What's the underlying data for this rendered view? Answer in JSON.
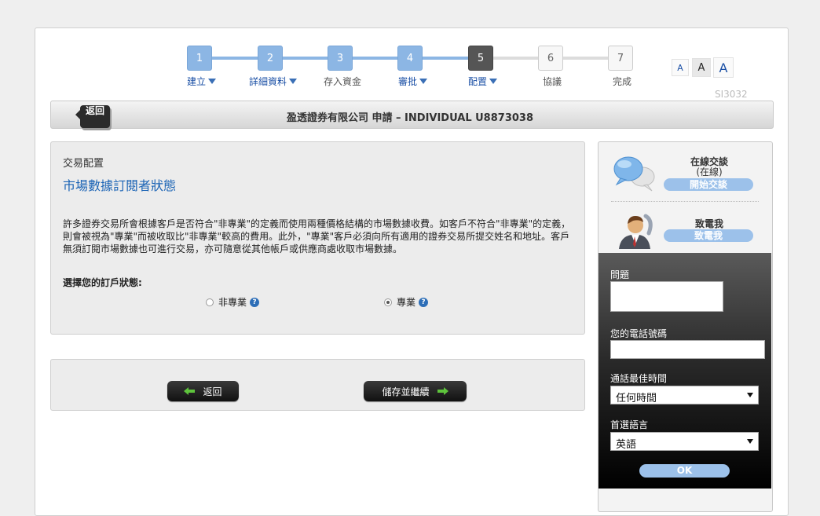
{
  "wizard": {
    "steps": [
      {
        "num": "1",
        "label": "建立"
      },
      {
        "num": "2",
        "label": "詳細資料"
      },
      {
        "num": "3",
        "label": "存入資金"
      },
      {
        "num": "4",
        "label": "審批"
      },
      {
        "num": "5",
        "label": "配置"
      },
      {
        "num": "6",
        "label": "協議"
      },
      {
        "num": "7",
        "label": "完成"
      }
    ],
    "current_step": 5
  },
  "font_size_options": [
    "A",
    "A",
    "A"
  ],
  "page_code": "SI3032",
  "header": {
    "back_label": "返回",
    "title": "盈透證券有限公司 申請 – INDIVIDUAL U8873038"
  },
  "content": {
    "section_label": "交易配置",
    "section_title": "市場數據訂閱者狀態",
    "description": "許多證券交易所會根據客戶是否符合\"非專業\"的定義而使用兩種價格結構的市場數據收費。如客戶不符合\"非專業\"的定義，則會被視為\"專業\"而被收取比\"非專業\"較高的費用。此外，\"專業\"客戶必須向所有適用的證券交易所提交姓名和地址。客戶無須訂閱市場數據也可進行交易，亦可隨意從其他帳戶或供應商處收取市場數據。",
    "choose_label": "選擇您的訂戶狀態:",
    "options": [
      {
        "label": "非專業",
        "selected": false
      },
      {
        "label": "專業",
        "selected": true
      }
    ]
  },
  "actions": {
    "back_label": "返回",
    "continue_label": "儲存並繼續"
  },
  "sidebar": {
    "chat": {
      "title": "在線交談",
      "status": "(在線)",
      "button": "開始交談"
    },
    "call": {
      "title": "致電我",
      "button": "致電我"
    },
    "form": {
      "question_label": "問題",
      "phone_label": "您的電話號碼",
      "time_label": "通話最佳時間",
      "time_value": "任何時間",
      "lang_label": "首選語言",
      "lang_value": "英語",
      "ok_label": "OK"
    }
  },
  "colors": {
    "accent": "#8cb6e4",
    "link": "#1a4fa5",
    "current": "#555555",
    "pill": "#9cc1ea"
  }
}
